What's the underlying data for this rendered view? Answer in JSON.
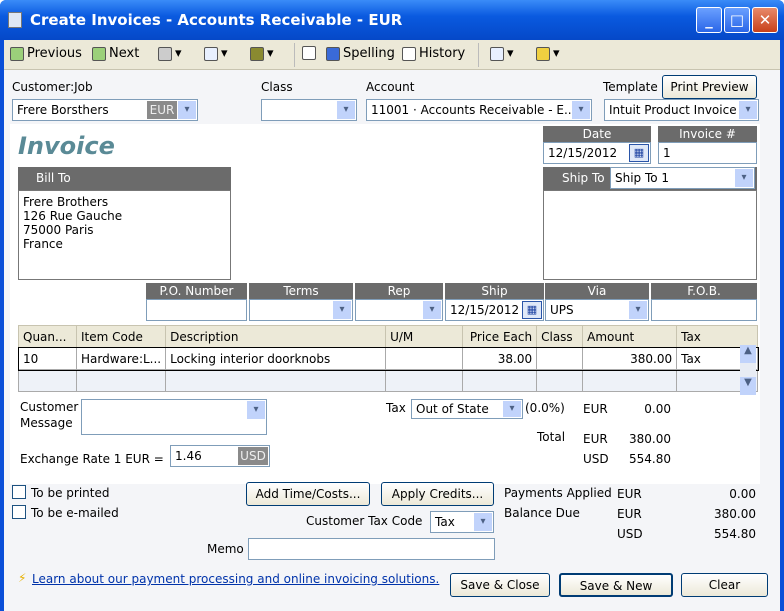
{
  "window": {
    "title": "Create Invoices - Accounts Receivable - EUR"
  },
  "toolbar": {
    "previous": "Previous",
    "next": "Next",
    "spelling": "Spelling",
    "history": "History"
  },
  "header": {
    "customer_label": "Customer:Job",
    "customer_value": "Frere Borsthers",
    "customer_currency": "EUR",
    "class_label": "Class",
    "class_value": "",
    "account_label": "Account",
    "account_value": "11001 · Accounts Receivable - E...",
    "template_label": "Template",
    "print_preview": "Print Preview",
    "template_value": "Intuit Product Invoice"
  },
  "invoice": {
    "title": "Invoice",
    "date_label": "Date",
    "date_value": "12/15/2012",
    "number_label": "Invoice #",
    "number_value": "1",
    "bill_to_label": "Bill To",
    "bill_to_lines": [
      "Frere Brothers",
      "126 Rue Gauche",
      "75000 Paris",
      "France"
    ],
    "ship_to_label": "Ship To",
    "ship_to_value": "Ship To 1"
  },
  "shipping": {
    "po_label": "P.O. Number",
    "terms_label": "Terms",
    "rep_label": "Rep",
    "ship_label": "Ship",
    "ship_value": "12/15/2012",
    "via_label": "Via",
    "via_value": "UPS",
    "fob_label": "F.O.B."
  },
  "items": {
    "columns": [
      "Quan...",
      "Item Code",
      "Description",
      "U/M",
      "Price Each",
      "Class",
      "Amount",
      "Tax"
    ],
    "rows": [
      [
        "10",
        "Hardware:L...",
        "Locking interior doorknobs",
        "",
        "38.00",
        "",
        "380.00",
        "Tax"
      ]
    ]
  },
  "totals": {
    "customer_message_label1": "Customer",
    "customer_message_label2": "Message",
    "tax_label": "Tax",
    "tax_value": "Out of State",
    "tax_rate": "(0.0%)",
    "tax_currency": "EUR",
    "tax_amount": "0.00",
    "total_label": "Total",
    "total_eur_currency": "EUR",
    "total_eur": "380.00",
    "total_usd_currency": "USD",
    "total_usd": "554.80",
    "exchange_label": "Exchange Rate 1 EUR =",
    "exchange_value": "1.46",
    "exchange_currency": "USD"
  },
  "footer": {
    "to_be_printed": "To be printed",
    "to_be_emailed": "To be e-mailed",
    "add_time_costs": "Add Time/Costs...",
    "apply_credits": "Apply Credits...",
    "customer_tax_code_label": "Customer Tax Code",
    "customer_tax_code_value": "Tax",
    "memo_label": "Memo",
    "memo_value": "",
    "payments_applied_label": "Payments Applied",
    "payments_applied_currency": "EUR",
    "payments_applied": "0.00",
    "balance_due_label": "Balance Due",
    "balance_due_eur_currency": "EUR",
    "balance_due_eur": "380.00",
    "balance_due_usd_currency": "USD",
    "balance_due_usd": "554.80",
    "learn_link": "Learn about our payment processing and online invoicing solutions.",
    "save_close": "Save & Close",
    "save_new": "Save & New",
    "clear": "Clear"
  }
}
